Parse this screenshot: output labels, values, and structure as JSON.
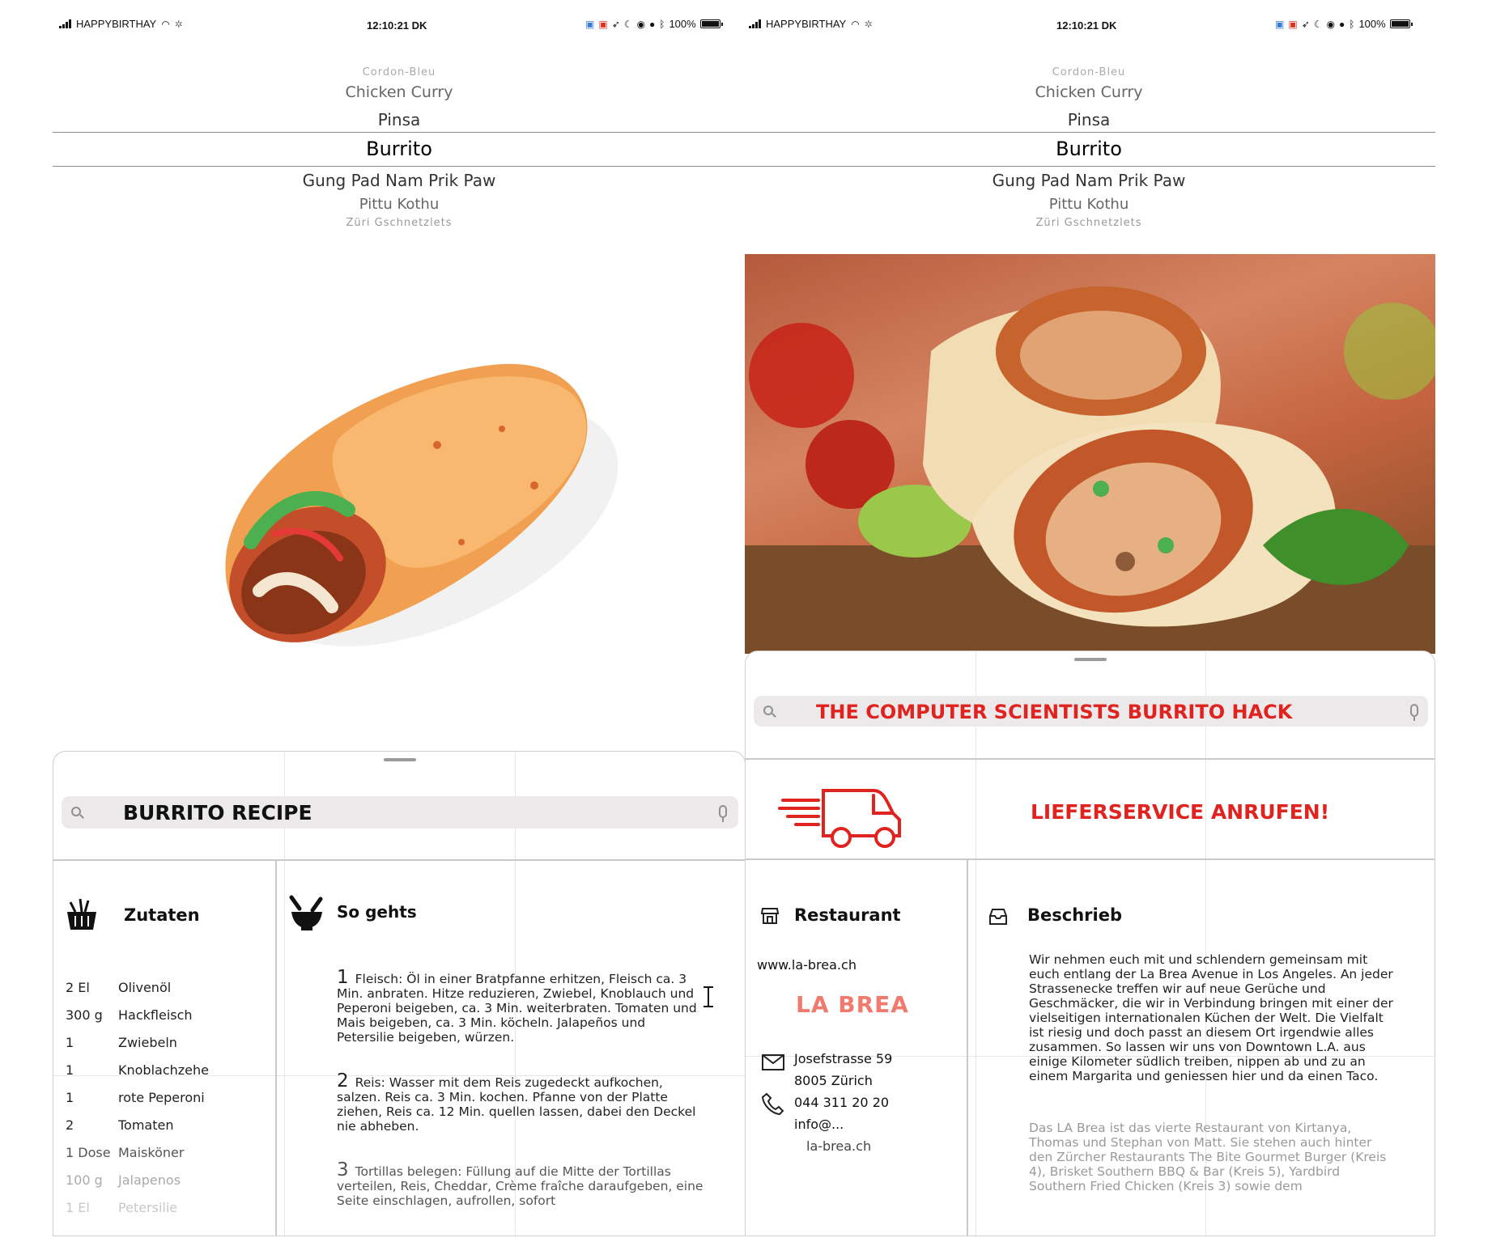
{
  "status_bar": {
    "carrier": "HAPPYBIRTHAY",
    "time": "12:10:21 DK",
    "battery": "100%"
  },
  "picker": {
    "items": [
      "Cordon-Bleu",
      "Chicken Curry",
      "Pinsa",
      "Burrito",
      "Gung Pad Nam Prik Paw",
      "Pittu Kothu",
      "Züri Gschnetzlets"
    ],
    "selected": "Burrito"
  },
  "left_panel": {
    "search_value": "BURRITO RECIPE",
    "ingredients_title": "Zutaten",
    "steps_title": "So gehts",
    "ingredients": [
      {
        "qty": "2 El",
        "name": "Olivenöl"
      },
      {
        "qty": "300 g",
        "name": "Hackfleisch"
      },
      {
        "qty": "1",
        "name": "Zwiebeln"
      },
      {
        "qty": "1",
        "name": "Knoblachzehe"
      },
      {
        "qty": "1",
        "name": "rote Peperoni"
      },
      {
        "qty": "2",
        "name": "Tomaten"
      },
      {
        "qty": "1 Dose",
        "name": "Maisköner"
      },
      {
        "qty": "100 g",
        "name": "Jalapenos"
      },
      {
        "qty": "1 El",
        "name": "Petersilie"
      }
    ],
    "steps": [
      {
        "num": "1",
        "text": "Fleisch: Öl in einer Bratpfanne erhitzen, Fleisch ca. 3 Min. anbraten. Hitze reduzieren, Zwiebel, Knoblauch und Peperoni beigeben, ca. 3 Min. weiterbraten. Tomaten und Mais beigeben, ca. 3 Min. köcheln. Jalapeños und Petersilie beigeben, würzen."
      },
      {
        "num": "2",
        "text": "Reis: Wasser mit dem Reis zugedeckt aufkochen, salzen. Reis ca. 3 Min. kochen. Pfanne von der Platte ziehen, Reis ca. 12 Min. quellen lassen, dabei den Deckel nie abheben."
      },
      {
        "num": "3",
        "text": "Tortillas belegen: Füllung auf die Mitte der Tortillas verteilen, Reis, Cheddar, Crème fraîche daraufgeben, eine Seite einschlagen, aufrollen, sofort"
      }
    ]
  },
  "right_panel": {
    "search_value": "THE COMPUTER SCIENTISTS BURRITO HACK",
    "delivery_label": "LIEFERSERVICE ANRUFEN!",
    "restaurant_title": "Restaurant",
    "website": "www.la-brea.ch",
    "restaurant_name": "LA BREA",
    "address_line1": "Josefstrasse 59",
    "address_line2": "8005 Zürich",
    "phone": "044 311 20 20",
    "email_line1": "info@...",
    "email_line2": "la-brea.ch",
    "description_title": "Beschrieb",
    "description_p1": "Wir nehmen euch mit und schlendern gemeinsam mit euch entlang der La Brea Avenue in Los Angeles. An jeder Strassenecke treffen wir auf neue Gerüche und Geschmäcker, die wir in Verbindung bringen mit einer der vielseitigen internationalen Küchen der Welt. Die Vielfalt ist riesig und doch passt an diesem Ort irgendwie alles zusammen. So lassen wir uns von Downtown L.A. aus einige Kilometer südlich treiben, nippen ab und zu an einem Margarita und geniessen hier und da einen Taco.",
    "description_p2": "Das LA Brea ist das vierte Restaurant von Kirtanya, Thomas und Stephan von Matt. Sie stehen auch hinter den Zürcher Restaurants The Bite Gourmet Burger (Kreis 4), Brisket Southern BBQ & Bar (Kreis 5), Yardbird Southern Fried Chicken (Kreis 3) sowie dem"
  },
  "colors": {
    "accent_red": "#e0231f",
    "search_bg": "#ebe9ea"
  }
}
